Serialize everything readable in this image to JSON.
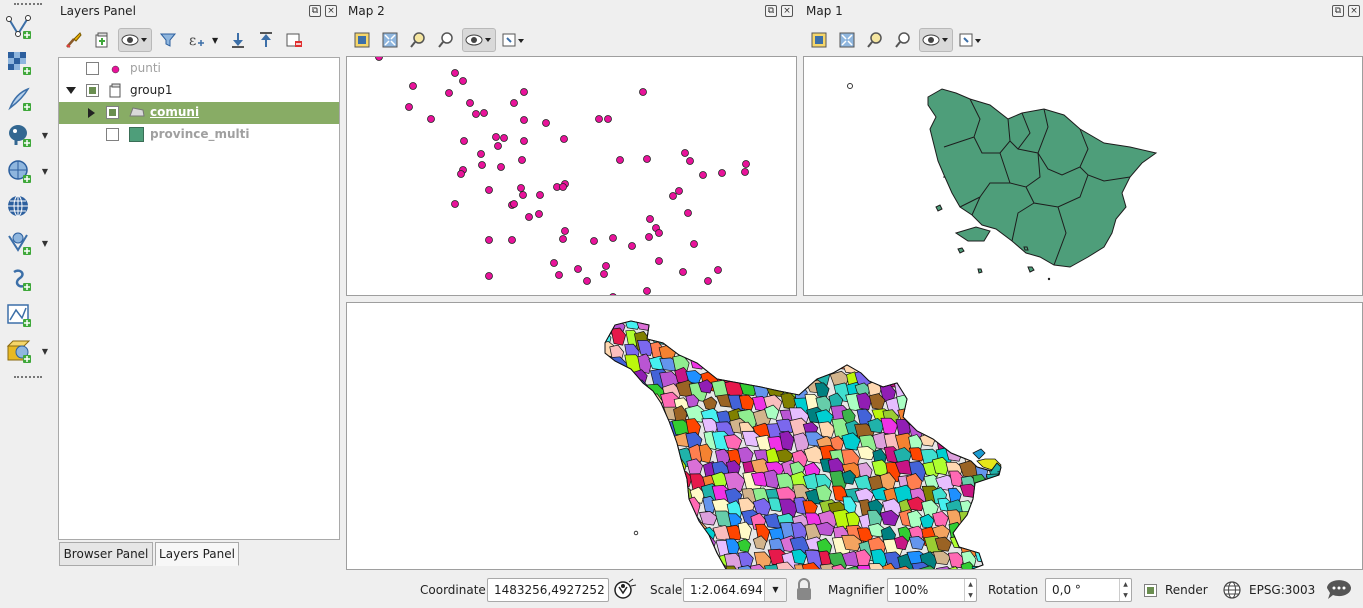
{
  "left_toolbar": {
    "icons": [
      "add-vector-layer-icon",
      "add-raster-layer-icon",
      "add-delimited-text-icon",
      "add-postgis-layer-icon",
      "add-wms-layer-icon",
      "add-wcs-layer-icon",
      "add-wfs-layer-icon",
      "add-spatialite-layer-icon",
      "add-vector-tile-icon",
      "add-virtual-layer-icon"
    ]
  },
  "layers_panel": {
    "title": "Layers Panel",
    "items": [
      {
        "label": "punti",
        "checked": false,
        "type": "point"
      },
      {
        "label": "group1",
        "checked": true,
        "type": "group"
      },
      {
        "label": "comuni",
        "checked": true,
        "type": "polygon",
        "selected": true
      },
      {
        "label": "province_multi",
        "checked": false,
        "type": "polygon"
      }
    ],
    "tabs": [
      "Browser Panel",
      "Layers Panel"
    ]
  },
  "map2": {
    "title": "Map 2"
  },
  "map1": {
    "title": "Map 1"
  },
  "status_bar": {
    "coordinate_label": "Coordinate",
    "coordinate_value": "1483256,4927252",
    "scale_label": "Scale",
    "scale_value": "1:2.064.694",
    "magnifier_label": "Magnifier",
    "magnifier_value": "100%",
    "rotation_label": "Rotation",
    "rotation_value": "0,0 °",
    "render_label": "Render",
    "render_checked": true,
    "crs_label": "EPSG:3003"
  },
  "colors": {
    "selection": "#88ac65",
    "point_fill": "#e8139a",
    "province_fill": "#4e9e7a"
  }
}
